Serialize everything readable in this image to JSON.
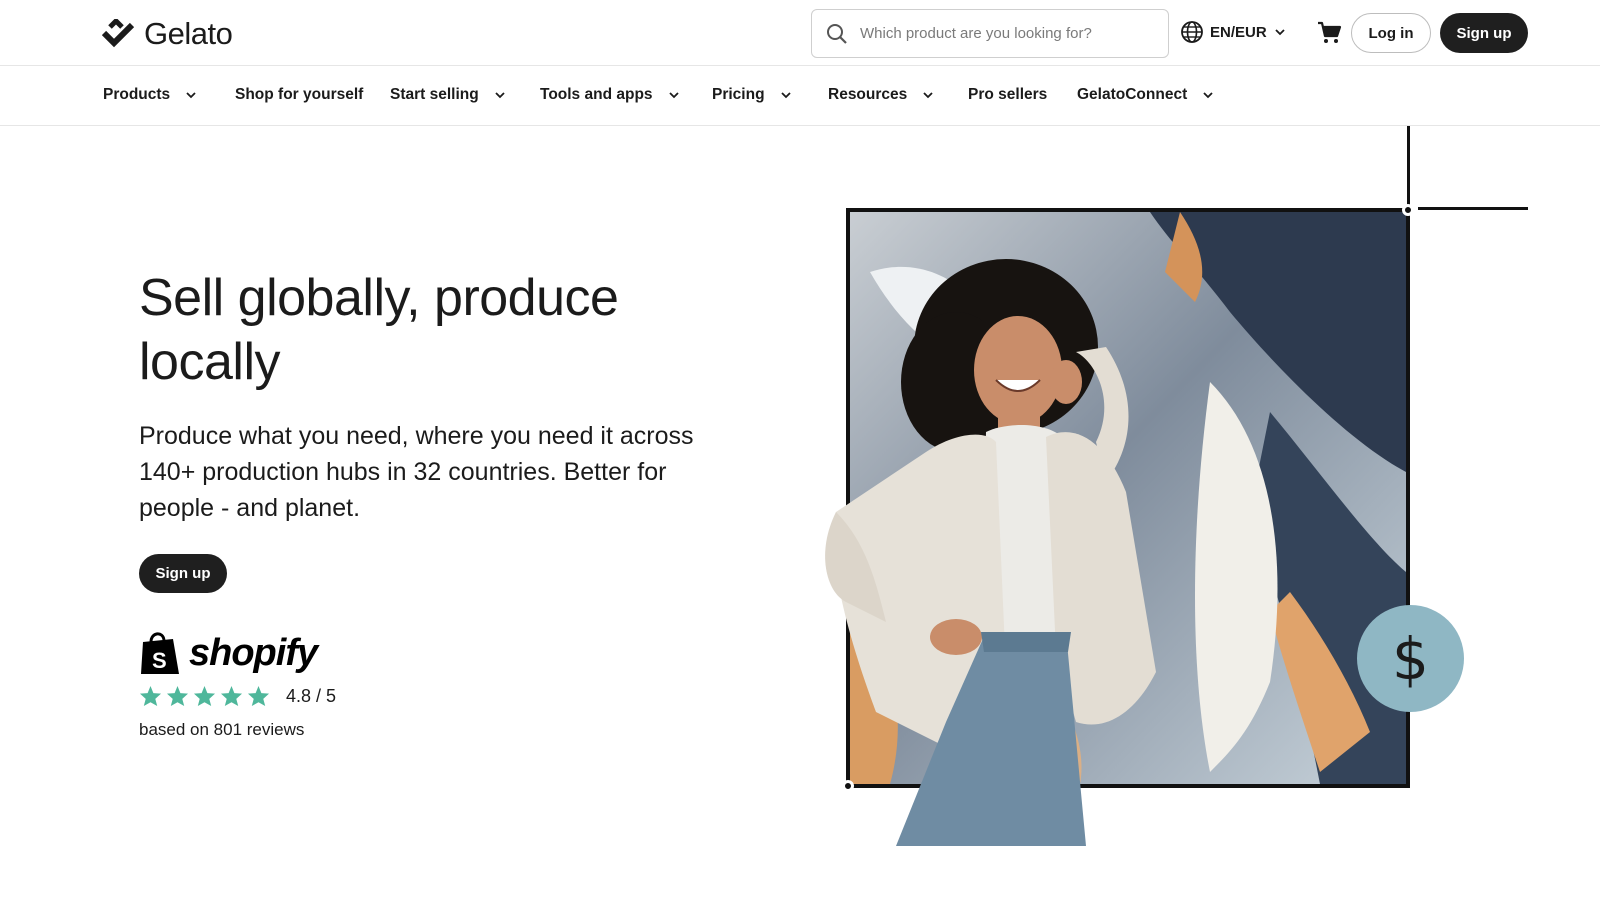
{
  "header": {
    "brand": "Gelato",
    "search_placeholder": "Which product are you looking for?",
    "locale": "EN/EUR",
    "login_label": "Log in",
    "signup_label": "Sign up"
  },
  "nav": {
    "items": [
      {
        "label": "Products",
        "has_dropdown": true
      },
      {
        "label": "Shop for yourself",
        "has_dropdown": false
      },
      {
        "label": "Start selling",
        "has_dropdown": true
      },
      {
        "label": "Tools and apps",
        "has_dropdown": true
      },
      {
        "label": "Pricing",
        "has_dropdown": true
      },
      {
        "label": "Resources",
        "has_dropdown": true
      },
      {
        "label": "Pro sellers",
        "has_dropdown": false
      },
      {
        "label": "GelatoConnect",
        "has_dropdown": true
      }
    ]
  },
  "hero": {
    "title": "Sell globally, produce locally",
    "subtitle": "Produce what you need, where you need it across 140+ production hubs in 32 countries. Better for people - and planet.",
    "cta_label": "Sign up"
  },
  "rating": {
    "platform": "shopify",
    "stars": 5,
    "value": "4.8 / 5",
    "reviews": "based on 801 reviews"
  },
  "colors": {
    "dark": "#1f1f1f",
    "star": "#4fb79b",
    "coin": "#8fb7c4"
  },
  "icons": {
    "coin_symbol": "$"
  }
}
